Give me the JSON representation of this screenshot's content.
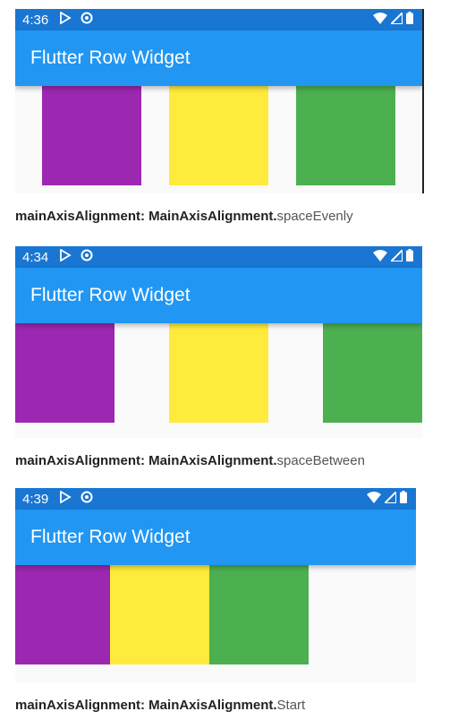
{
  "screens": [
    {
      "time": "4:36",
      "app_title": "Flutter Row Widget",
      "caption_bold": "mainAxisAlignment: MainAxisAlignment.",
      "caption_value": "spaceEvenly"
    },
    {
      "time": "4:34",
      "app_title": "Flutter Row Widget",
      "caption_bold": "mainAxisAlignment: MainAxisAlignment.",
      "caption_value": "spaceBetween"
    },
    {
      "time": "4:39",
      "app_title": "Flutter Row Widget",
      "caption_bold": "mainAxisAlignment: MainAxisAlignment.",
      "caption_value": "Start"
    }
  ],
  "status_icons": [
    "play-store-icon",
    "data-saver-icon",
    "wifi-icon",
    "signal-icon",
    "battery-icon"
  ],
  "colors": {
    "status_bar": "#1976d2",
    "app_bar": "#2196f3",
    "box_purple": "#9c27b0",
    "box_yellow": "#ffeb3b",
    "box_green": "#4caf50"
  }
}
